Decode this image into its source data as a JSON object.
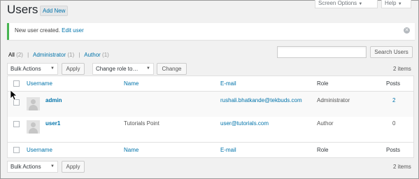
{
  "header": {
    "title": "Users",
    "add_new_label": "Add New",
    "screen_options_label": "Screen Options",
    "help_label": "Help"
  },
  "notice": {
    "text": "New user created.",
    "link_label": "Edit user"
  },
  "filters": {
    "all_label": "All",
    "all_count": "(2)",
    "administrator_label": "Administrator",
    "administrator_count": "(1)",
    "author_label": "Author",
    "author_count": "(1)",
    "separator": "|"
  },
  "search": {
    "value": "",
    "button_label": "Search Users"
  },
  "toolbar_top": {
    "bulk_actions_value": "Bulk Actions",
    "apply_label": "Apply",
    "change_role_value": "Change role to…",
    "change_label": "Change",
    "items_count": "2 items"
  },
  "toolbar_bottom": {
    "bulk_actions_value": "Bulk Actions",
    "apply_label": "Apply",
    "items_count": "2 items"
  },
  "table": {
    "columns": {
      "username": "Username",
      "name": "Name",
      "email": "E-mail",
      "role": "Role",
      "posts": "Posts"
    },
    "rows": [
      {
        "username": "admin",
        "name": "",
        "email": "rushali.bhatkande@tekbuds.com",
        "role": "Administrator",
        "posts": "2"
      },
      {
        "username": "user1",
        "name": "Tutorials Point",
        "email": "user@tutorials.com",
        "role": "Author",
        "posts": "0"
      }
    ]
  },
  "colors": {
    "link": "#0073aa",
    "notice_border": "#46b450",
    "background": "#f1f1f1"
  },
  "icons": {
    "dropdown": "chevron-down-icon",
    "dismiss": "close-icon",
    "avatar": "avatar-placeholder-icon",
    "cursor": "mouse-pointer-icon"
  }
}
